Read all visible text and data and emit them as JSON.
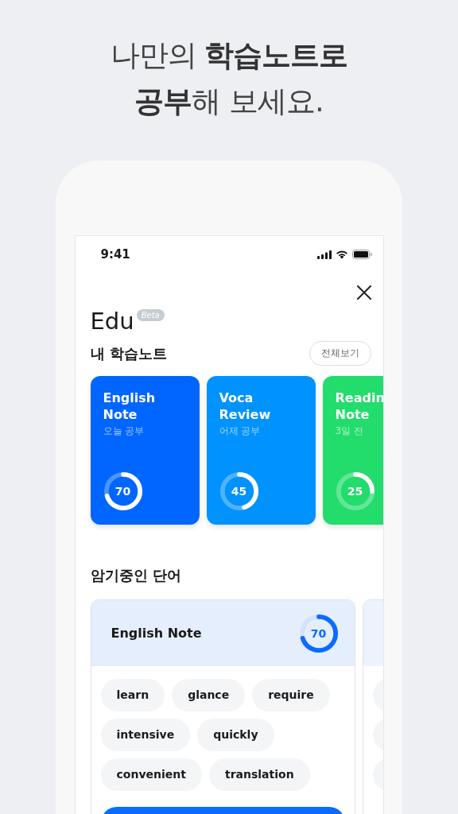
{
  "headline": {
    "lines": [
      "나만의 **학습노트로**",
      "**공부**해 보세요."
    ]
  },
  "status_bar": {
    "time": "9:41"
  },
  "app": {
    "title": "Edu",
    "badge": "Beta"
  },
  "notes_section": {
    "title": "내 학습노트",
    "view_all": "전체보기",
    "notes": [
      {
        "title_lines": [
          "English",
          "Note"
        ],
        "subtitle": "오늘 공부",
        "color": "#0066ff",
        "level": 0.7,
        "reading": "70"
      },
      {
        "title_lines": [
          "Voca",
          "Review"
        ],
        "subtitle": "어제 공부",
        "color": "#0092ff",
        "level": 0.45,
        "reading": "45"
      },
      {
        "title_lines": [
          "Readin",
          "Note"
        ],
        "subtitle": "3일 전",
        "color": "#22dc6c",
        "level": 0.25,
        "reading": "25"
      }
    ]
  },
  "words_section": {
    "title": "암기중인 단어",
    "cards": [
      {
        "kind": "full",
        "title": "English Note",
        "level": 0.7,
        "reading": "70",
        "words": [
          "learn",
          "glance",
          "require",
          "intensive",
          "quickly",
          "convenient",
          "translation"
        ],
        "has_button": true
      },
      {
        "kind": "partial"
      }
    ]
  }
}
